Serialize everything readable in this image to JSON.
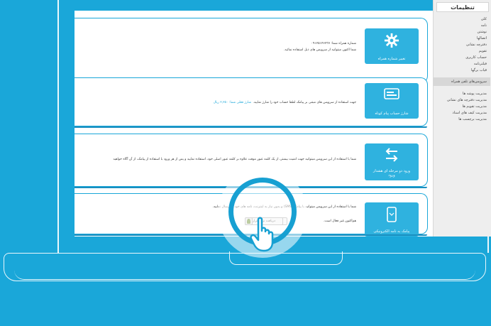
{
  "sidebar": {
    "title": "تنظیمات",
    "items": [
      {
        "label": "کلی"
      },
      {
        "label": "نامه"
      },
      {
        "label": "نوشتن"
      },
      {
        "label": "اتصالها"
      },
      {
        "label": "دفترچه نشانی"
      },
      {
        "label": "تقویم"
      },
      {
        "label": "حساب کاربری"
      },
      {
        "label": "فیلترنامه"
      },
      {
        "label": "قیاب برگها"
      },
      {
        "label": "سرویس‌های تلفن همراه",
        "active": true
      },
      {
        "label": "مدیریت پوشه ها"
      },
      {
        "label": "مدیریت دفترچه های نشانی"
      },
      {
        "label": "مدیریت تقویم ها"
      },
      {
        "label": "مدیریت کیف های اسناد"
      },
      {
        "label": "مدیریت برچسب ها"
      }
    ]
  },
  "cards": [
    {
      "tile_label": "تغییر شماره همراه",
      "icon": "gear-icon",
      "line1": "شماره همراه شما: ۰۹۱۲۵۱۴۶۲۳۷",
      "line2": "شما اکنون میتوانید از سرویس های ذیل استفاده نمائید."
    },
    {
      "tile_label": "شارژ حساب پیام کوتاه",
      "icon": "card-icon",
      "line1": "جهت استفاده از سرویس های مبتنی بر پیامک لطفا حساب خود را شارژ نمایید.",
      "balance_label": "شارژ فعلی شما: ۲,۲۵۰ ریال"
    },
    {
      "tile_label": "ورود دو مرحله ای هشدار ورود",
      "icon": "arrows-icon",
      "line1": "شما با استفاده از این سرویس میتوانید جهت امنیت بیشتر، از یک کلمه عبور موقت علاوه بر کلمه عبور اصلی خود، استفاده نمایید و پس از هر ورود با استفاده از پیامک، از آن آگاه خواهید"
    },
    {
      "tile_label": "پیامک به نامه الکترونیکی",
      "icon": "phone-icon",
      "line1": "شما با استفاده از این سرویس میتوانید با پیامک (SMS) و بدون نیاز به اینترنت، نامه های خود را ارسال نمایید.",
      "line2": "هم‌اکنون غیر فعال است.",
      "activate_label": "فعالسازی",
      "download_label": "دریافت نرم افزار"
    }
  ]
}
